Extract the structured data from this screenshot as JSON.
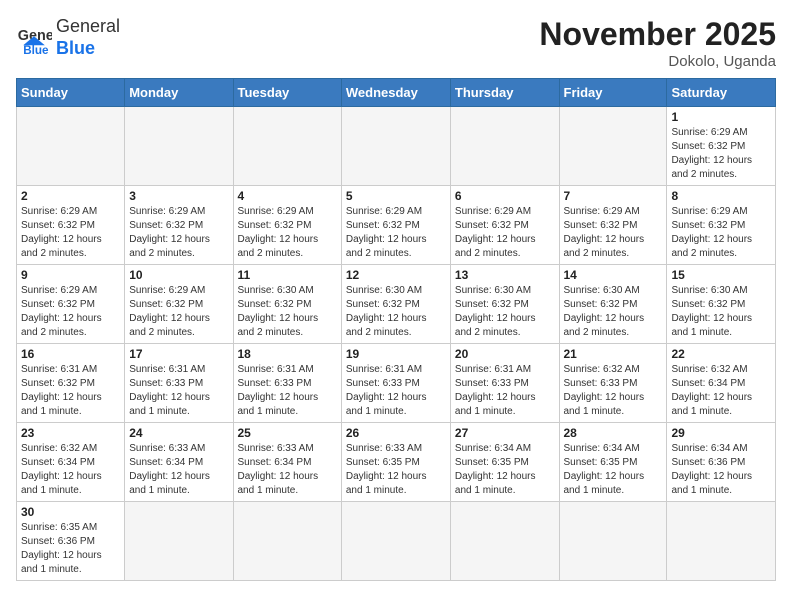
{
  "header": {
    "logo_general": "General",
    "logo_blue": "Blue",
    "month_title": "November 2025",
    "location": "Dokolo, Uganda"
  },
  "weekdays": [
    "Sunday",
    "Monday",
    "Tuesday",
    "Wednesday",
    "Thursday",
    "Friday",
    "Saturday"
  ],
  "weeks": [
    [
      {
        "day": "",
        "info": ""
      },
      {
        "day": "",
        "info": ""
      },
      {
        "day": "",
        "info": ""
      },
      {
        "day": "",
        "info": ""
      },
      {
        "day": "",
        "info": ""
      },
      {
        "day": "",
        "info": ""
      },
      {
        "day": "1",
        "info": "Sunrise: 6:29 AM\nSunset: 6:32 PM\nDaylight: 12 hours and 2 minutes."
      }
    ],
    [
      {
        "day": "2",
        "info": "Sunrise: 6:29 AM\nSunset: 6:32 PM\nDaylight: 12 hours and 2 minutes."
      },
      {
        "day": "3",
        "info": "Sunrise: 6:29 AM\nSunset: 6:32 PM\nDaylight: 12 hours and 2 minutes."
      },
      {
        "day": "4",
        "info": "Sunrise: 6:29 AM\nSunset: 6:32 PM\nDaylight: 12 hours and 2 minutes."
      },
      {
        "day": "5",
        "info": "Sunrise: 6:29 AM\nSunset: 6:32 PM\nDaylight: 12 hours and 2 minutes."
      },
      {
        "day": "6",
        "info": "Sunrise: 6:29 AM\nSunset: 6:32 PM\nDaylight: 12 hours and 2 minutes."
      },
      {
        "day": "7",
        "info": "Sunrise: 6:29 AM\nSunset: 6:32 PM\nDaylight: 12 hours and 2 minutes."
      },
      {
        "day": "8",
        "info": "Sunrise: 6:29 AM\nSunset: 6:32 PM\nDaylight: 12 hours and 2 minutes."
      }
    ],
    [
      {
        "day": "9",
        "info": "Sunrise: 6:29 AM\nSunset: 6:32 PM\nDaylight: 12 hours and 2 minutes."
      },
      {
        "day": "10",
        "info": "Sunrise: 6:29 AM\nSunset: 6:32 PM\nDaylight: 12 hours and 2 minutes."
      },
      {
        "day": "11",
        "info": "Sunrise: 6:30 AM\nSunset: 6:32 PM\nDaylight: 12 hours and 2 minutes."
      },
      {
        "day": "12",
        "info": "Sunrise: 6:30 AM\nSunset: 6:32 PM\nDaylight: 12 hours and 2 minutes."
      },
      {
        "day": "13",
        "info": "Sunrise: 6:30 AM\nSunset: 6:32 PM\nDaylight: 12 hours and 2 minutes."
      },
      {
        "day": "14",
        "info": "Sunrise: 6:30 AM\nSunset: 6:32 PM\nDaylight: 12 hours and 2 minutes."
      },
      {
        "day": "15",
        "info": "Sunrise: 6:30 AM\nSunset: 6:32 PM\nDaylight: 12 hours and 1 minute."
      }
    ],
    [
      {
        "day": "16",
        "info": "Sunrise: 6:31 AM\nSunset: 6:32 PM\nDaylight: 12 hours and 1 minute."
      },
      {
        "day": "17",
        "info": "Sunrise: 6:31 AM\nSunset: 6:33 PM\nDaylight: 12 hours and 1 minute."
      },
      {
        "day": "18",
        "info": "Sunrise: 6:31 AM\nSunset: 6:33 PM\nDaylight: 12 hours and 1 minute."
      },
      {
        "day": "19",
        "info": "Sunrise: 6:31 AM\nSunset: 6:33 PM\nDaylight: 12 hours and 1 minute."
      },
      {
        "day": "20",
        "info": "Sunrise: 6:31 AM\nSunset: 6:33 PM\nDaylight: 12 hours and 1 minute."
      },
      {
        "day": "21",
        "info": "Sunrise: 6:32 AM\nSunset: 6:33 PM\nDaylight: 12 hours and 1 minute."
      },
      {
        "day": "22",
        "info": "Sunrise: 6:32 AM\nSunset: 6:34 PM\nDaylight: 12 hours and 1 minute."
      }
    ],
    [
      {
        "day": "23",
        "info": "Sunrise: 6:32 AM\nSunset: 6:34 PM\nDaylight: 12 hours and 1 minute."
      },
      {
        "day": "24",
        "info": "Sunrise: 6:33 AM\nSunset: 6:34 PM\nDaylight: 12 hours and 1 minute."
      },
      {
        "day": "25",
        "info": "Sunrise: 6:33 AM\nSunset: 6:34 PM\nDaylight: 12 hours and 1 minute."
      },
      {
        "day": "26",
        "info": "Sunrise: 6:33 AM\nSunset: 6:35 PM\nDaylight: 12 hours and 1 minute."
      },
      {
        "day": "27",
        "info": "Sunrise: 6:34 AM\nSunset: 6:35 PM\nDaylight: 12 hours and 1 minute."
      },
      {
        "day": "28",
        "info": "Sunrise: 6:34 AM\nSunset: 6:35 PM\nDaylight: 12 hours and 1 minute."
      },
      {
        "day": "29",
        "info": "Sunrise: 6:34 AM\nSunset: 6:36 PM\nDaylight: 12 hours and 1 minute."
      }
    ],
    [
      {
        "day": "30",
        "info": "Sunrise: 6:35 AM\nSunset: 6:36 PM\nDaylight: 12 hours and 1 minute."
      },
      {
        "day": "",
        "info": ""
      },
      {
        "day": "",
        "info": ""
      },
      {
        "day": "",
        "info": ""
      },
      {
        "day": "",
        "info": ""
      },
      {
        "day": "",
        "info": ""
      },
      {
        "day": "",
        "info": ""
      }
    ]
  ]
}
